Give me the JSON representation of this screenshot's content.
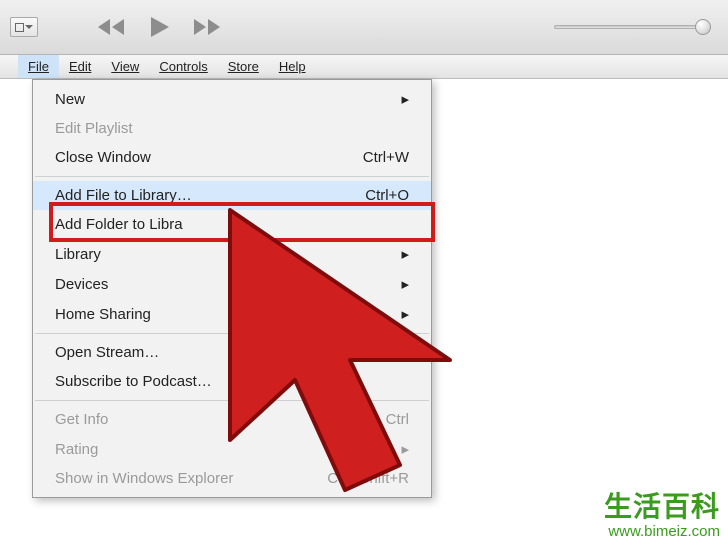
{
  "menubar": {
    "file": "File",
    "edit": "Edit",
    "view": "View",
    "controls": "Controls",
    "store": "Store",
    "help": "Help"
  },
  "dropdown": {
    "new": "New",
    "edit_playlist": "Edit Playlist",
    "close_window": "Close Window",
    "close_window_sc": "Ctrl+W",
    "add_file": "Add File to Library…",
    "add_file_sc": "Ctrl+O",
    "add_folder": "Add Folder to Libra",
    "library": "Library",
    "devices": "Devices",
    "home_sharing": "Home Sharing",
    "open_stream": "Open Stream…",
    "subscribe_podcast": "Subscribe to Podcast…",
    "get_info": "Get Info",
    "get_info_sc": "Ctrl",
    "rating": "Rating",
    "show_explorer": "Show in Windows Explorer",
    "show_explorer_sc": "Ctrl+Shift+R"
  },
  "watermark": {
    "title": "生活百科",
    "url": "www.bimeiz.com"
  }
}
